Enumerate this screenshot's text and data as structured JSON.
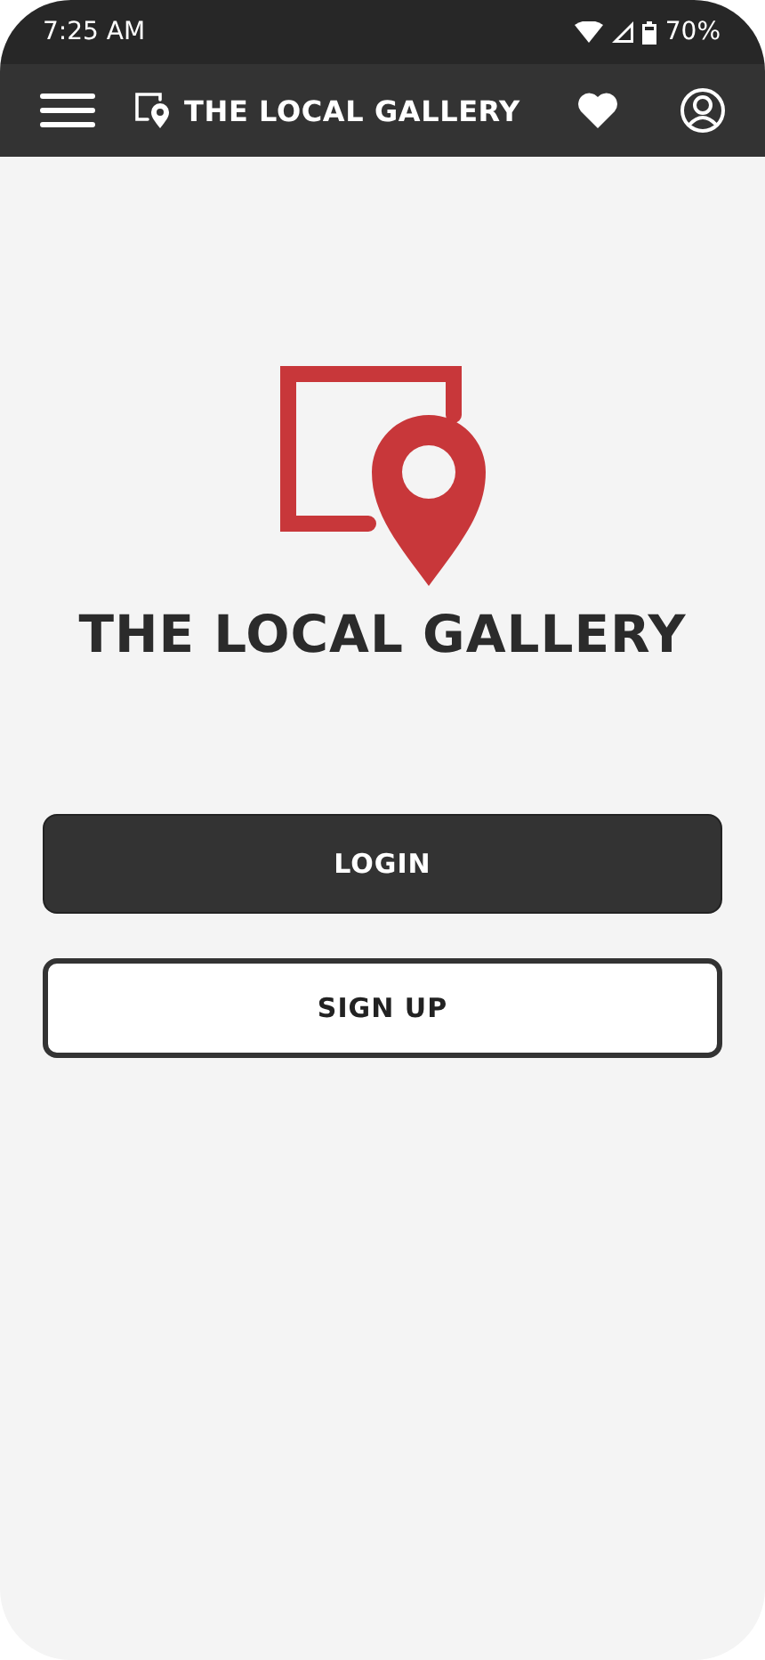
{
  "status_bar": {
    "time": "7:25 AM",
    "battery": "70%"
  },
  "app_bar": {
    "title": "THE LOCAL GALLERY"
  },
  "brand": {
    "name": "THE LOCAL GALLERY"
  },
  "buttons": [
    {
      "label": "LOGIN",
      "kind": "filled"
    },
    {
      "label": "SIGN UP",
      "kind": "outlined"
    }
  ]
}
